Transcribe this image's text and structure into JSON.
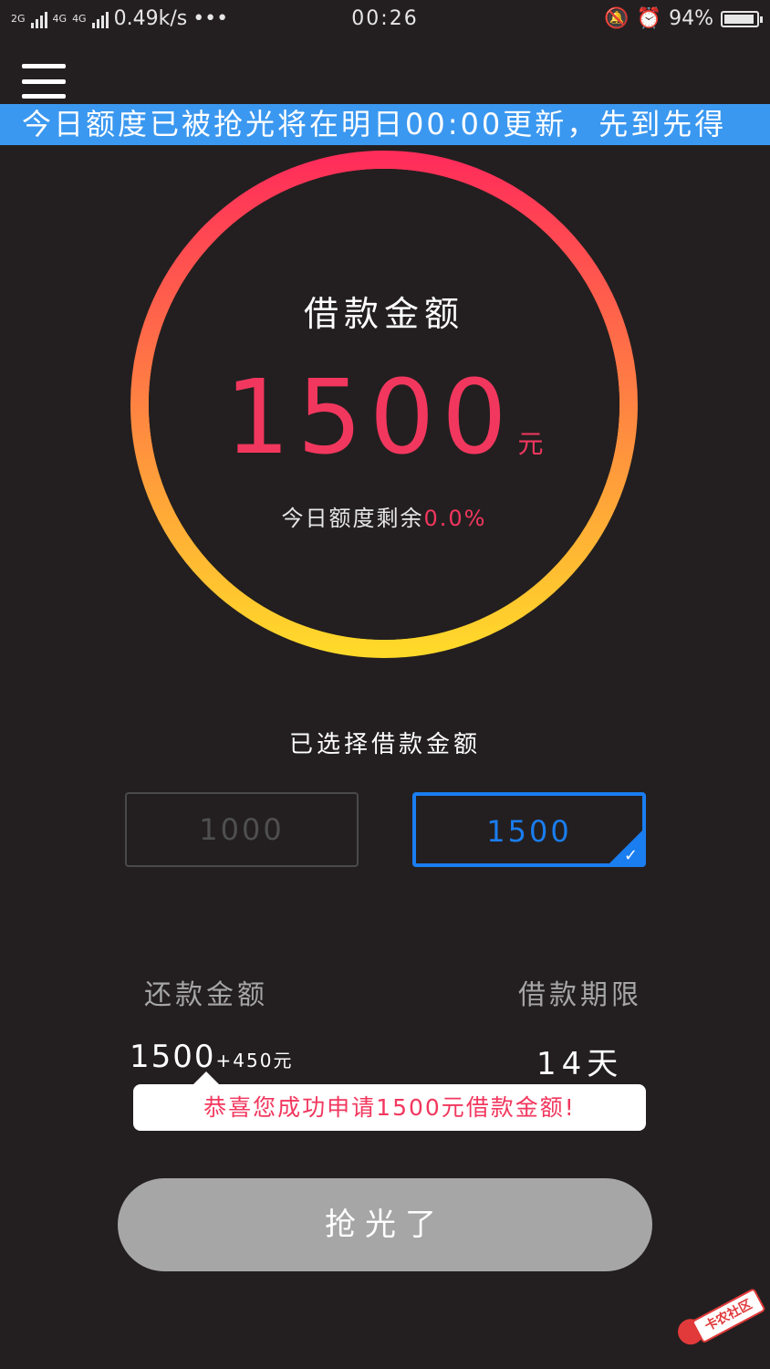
{
  "status_bar": {
    "net_2g": "2G",
    "net_4g_a": "4G",
    "net_4g_b": "4G",
    "speed": "0.49k/s",
    "more": "•••",
    "time": "00:26",
    "battery_percent": "94%",
    "battery_level": 0.94
  },
  "header": {
    "notice": "今日额度已被抢光将在明日00:00更新，先到先得"
  },
  "gauge": {
    "title": "借款金额",
    "amount": "1500",
    "unit": "元",
    "remaining_label": "今日额度剩余",
    "remaining_value": "0.0%"
  },
  "selection": {
    "label": "已选择借款金额",
    "options": [
      "1000",
      "1500"
    ],
    "selected": "1500"
  },
  "info": {
    "repay_label": "还款金额",
    "repay_value": "1500",
    "repay_extra": "+450元",
    "term_label": "借款期限",
    "term_value": "14天"
  },
  "toast": {
    "message": "恭喜您成功申请1500元借款金额!"
  },
  "action": {
    "button_label": "抢光了"
  },
  "watermark": {
    "text": "卡农社区"
  },
  "colors": {
    "background": "#231f20",
    "banner": "#3b98f0",
    "accent_red": "#f2375e",
    "accent_blue": "#1a7df0",
    "ring_top": "#ff2d5a",
    "ring_bottom": "#ffd92a",
    "button_disabled": "#a6a6a6"
  }
}
